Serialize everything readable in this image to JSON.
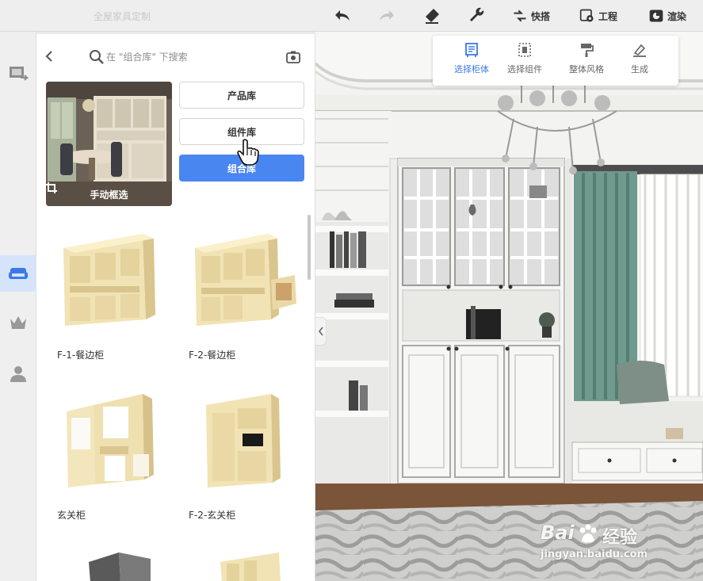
{
  "app": {
    "title": "全屋家具定制"
  },
  "toolbar": {
    "quick_label": "快搭",
    "project_label": "工程",
    "render_label": "渲染"
  },
  "panel": {
    "search_placeholder": "在 \"组合库\" 下搜索",
    "manual_select_label": "手动框选",
    "libraries": [
      {
        "label": "产品库",
        "active": false
      },
      {
        "label": "组件库",
        "active": false
      },
      {
        "label": "组合库",
        "active": true
      }
    ],
    "items": [
      {
        "label": "F-1-餐边柜"
      },
      {
        "label": "F-2-餐边柜"
      },
      {
        "label": "玄关柜"
      },
      {
        "label": "F-2-玄关柜"
      }
    ]
  },
  "tool_popup": {
    "tools": [
      {
        "label": "选择柜体",
        "icon": "cabinet-icon",
        "active": true
      },
      {
        "label": "选择组件",
        "icon": "select-component-icon",
        "active": false
      },
      {
        "label": "整体风格",
        "icon": "paint-roller-icon",
        "active": false
      },
      {
        "label": "生成",
        "icon": "generate-icon",
        "active": false
      }
    ]
  },
  "watermark": {
    "brand_left": "Bai",
    "brand_right": "经验",
    "url": "jingyan.baidu.com"
  },
  "colors": {
    "accent": "#4a86f0",
    "active_tool": "#3a78e8",
    "rail_active": "#d6e4fb"
  }
}
